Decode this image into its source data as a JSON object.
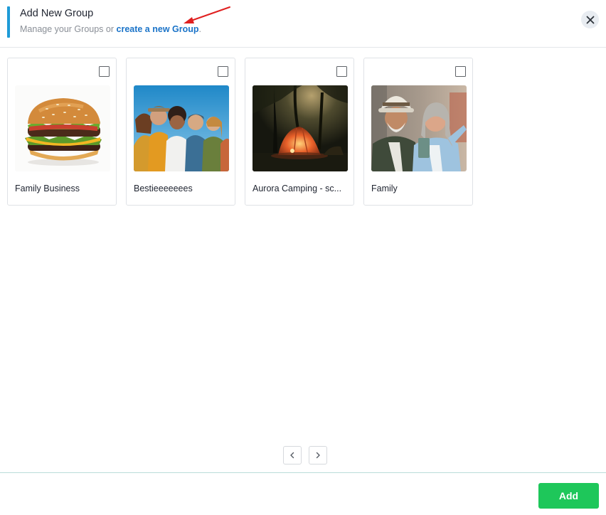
{
  "dialog": {
    "title": "Add New Group",
    "subtitle_prefix": "Manage your Groups or ",
    "subtitle_link": "create a new Group",
    "subtitle_suffix": ".",
    "accent_color": "#1e9bd7",
    "link_color": "#1a73c8"
  },
  "groups": [
    {
      "name": "Family Business",
      "image": "burger-photo",
      "checked": false
    },
    {
      "name": "Bestieeeeeees",
      "image": "friends-group-photo",
      "checked": false
    },
    {
      "name": "Aurora Camping - sc...",
      "image": "night-tent-camping-photo",
      "checked": false
    },
    {
      "name": "Family",
      "image": "couple-selfie-photo",
      "checked": false
    }
  ],
  "pagination": {
    "prev_icon": "chevron-left-icon",
    "next_icon": "chevron-right-icon"
  },
  "footer": {
    "add_label": "Add",
    "add_color": "#1ec75a"
  }
}
